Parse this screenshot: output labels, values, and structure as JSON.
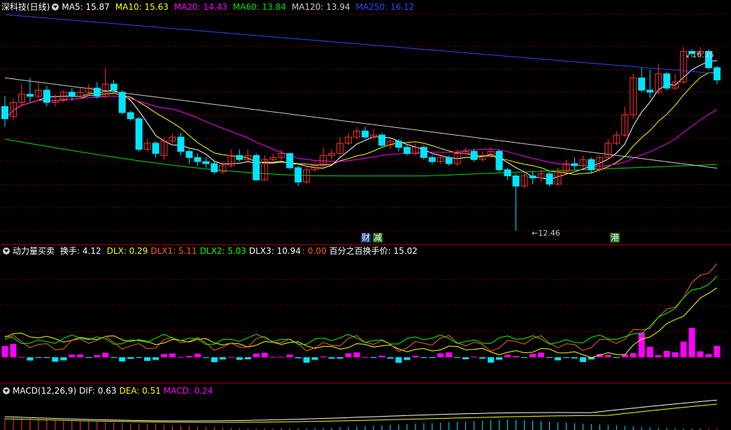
{
  "main_panel": {
    "title": "深科技(日线)",
    "ma": [
      {
        "label": "MA5: 15.87",
        "color": "#ffffff"
      },
      {
        "label": "MA10: 15.63",
        "color": "#ffff00"
      },
      {
        "label": "MA20: 14.43",
        "color": "#ff00ff"
      },
      {
        "label": "MA60: 13.84",
        "color": "#00e000"
      },
      {
        "label": "MA120: 13.94",
        "color": "#cccccc"
      },
      {
        "label": "MA250: 16.12",
        "color": "#3344ff"
      }
    ],
    "high_label": "16.35",
    "low_label": "12.46",
    "tags": [
      {
        "text": "财",
        "color": "#ffffff",
        "bg": "#1a3a8a"
      },
      {
        "text": "减",
        "color": "#ffffff",
        "bg": "#1f6e1f"
      },
      {
        "text": "港",
        "color": "#ffffff",
        "bg": "#1f6e1f"
      }
    ]
  },
  "power_panel": {
    "title": "动力量买卖",
    "items": [
      {
        "label": "换手: 4.12",
        "color": "#ffffff"
      },
      {
        "label": "DLX: 0.29",
        "color": "#ffff00"
      },
      {
        "label": "DLX1: 5.11",
        "color": "#ff6020"
      },
      {
        "label": "DLX2: 5.03",
        "color": "#00ff00"
      },
      {
        "label": "DLX3: 10.94",
        "color": "#ffffff"
      },
      {
        "label": ": 0.00",
        "color": "#ff6020"
      },
      {
        "label": "百分之百换手价: 15.02",
        "color": "#ffffff"
      }
    ]
  },
  "macd_panel": {
    "title": "MACD(12,26,9)",
    "items": [
      {
        "label": "DIF: 0.63",
        "color": "#ffffff"
      },
      {
        "label": "DEA: 0.51",
        "color": "#ffff00"
      },
      {
        "label": "MACD: 0.24",
        "color": "#ff00ff"
      }
    ]
  },
  "colors": {
    "up": "#ff3030",
    "down": "#00e5ff",
    "grid": "#7a0000",
    "divider": "#c00000",
    "ma5": "#ffffff",
    "ma10": "#ffff00",
    "ma20": "#ff00ff",
    "ma60": "#00e000",
    "ma120": "#cccccc",
    "ma250": "#3344ff",
    "dlx": "#ffff00",
    "dlx1": "#ff6020",
    "dlx2": "#00ff00",
    "bar_pos": "#ff00ff",
    "bar_neg": "#00e5ff"
  },
  "chart_data": {
    "type": "candlestick",
    "price_range": [
      12.2,
      17.8
    ],
    "candles": [
      [
        15.5,
        15.2,
        15.75,
        15.0
      ],
      [
        15.25,
        15.6,
        15.7,
        15.15
      ],
      [
        15.6,
        15.8,
        16.05,
        15.5
      ],
      [
        15.8,
        15.75,
        16.2,
        15.6
      ],
      [
        15.75,
        15.9,
        16.1,
        15.7
      ],
      [
        15.9,
        15.6,
        16.0,
        15.5
      ],
      [
        15.6,
        15.65,
        15.8,
        15.5
      ],
      [
        15.65,
        15.85,
        15.9,
        15.6
      ],
      [
        15.85,
        15.75,
        15.95,
        15.65
      ],
      [
        15.75,
        15.85,
        15.95,
        15.7
      ],
      [
        15.85,
        15.95,
        16.05,
        15.8
      ],
      [
        15.95,
        15.75,
        16.1,
        15.7
      ],
      [
        15.75,
        16.05,
        16.45,
        15.7
      ],
      [
        16.05,
        15.9,
        16.15,
        15.85
      ],
      [
        15.85,
        15.35,
        15.9,
        15.3
      ],
      [
        15.35,
        15.2,
        15.4,
        15.15
      ],
      [
        15.2,
        14.45,
        15.25,
        14.4
      ],
      [
        14.45,
        14.6,
        14.7,
        14.4
      ],
      [
        14.6,
        14.35,
        14.65,
        14.25
      ],
      [
        14.3,
        14.65,
        14.75,
        14.2
      ],
      [
        14.65,
        14.75,
        14.85,
        14.6
      ],
      [
        14.75,
        14.4,
        14.85,
        14.3
      ],
      [
        14.4,
        14.25,
        14.45,
        14.1
      ],
      [
        14.25,
        14.15,
        14.35,
        14.05
      ],
      [
        14.15,
        14.1,
        14.25,
        14.0
      ],
      [
        14.1,
        13.9,
        14.15,
        13.85
      ],
      [
        13.9,
        14.05,
        14.15,
        13.85
      ],
      [
        14.05,
        14.3,
        14.45,
        14.0
      ],
      [
        14.3,
        14.2,
        14.45,
        14.15
      ],
      [
        14.2,
        14.3,
        14.45,
        14.15
      ],
      [
        14.3,
        13.7,
        14.35,
        13.7
      ],
      [
        13.7,
        14.2,
        14.3,
        13.7
      ],
      [
        14.2,
        14.25,
        14.35,
        14.15
      ],
      [
        14.25,
        14.35,
        14.45,
        14.2
      ],
      [
        14.35,
        14.0,
        14.35,
        13.95
      ],
      [
        14.0,
        13.65,
        14.05,
        13.55
      ],
      [
        13.65,
        13.95,
        14.05,
        13.6
      ],
      [
        13.95,
        14.05,
        14.15,
        13.9
      ],
      [
        14.05,
        14.3,
        14.5,
        14.0
      ],
      [
        14.3,
        14.35,
        14.45,
        14.2
      ],
      [
        14.35,
        14.6,
        14.75,
        14.3
      ],
      [
        14.6,
        14.75,
        14.85,
        14.55
      ],
      [
        14.75,
        14.9,
        15.0,
        14.7
      ],
      [
        14.9,
        14.75,
        15.0,
        14.7
      ],
      [
        14.75,
        14.8,
        14.95,
        14.7
      ],
      [
        14.8,
        14.55,
        14.85,
        14.5
      ],
      [
        14.55,
        14.65,
        14.7,
        14.45
      ],
      [
        14.65,
        14.5,
        14.7,
        14.4
      ],
      [
        14.5,
        14.35,
        14.55,
        14.3
      ],
      [
        14.35,
        14.5,
        14.6,
        14.3
      ],
      [
        14.5,
        14.25,
        14.55,
        14.2
      ],
      [
        14.25,
        14.15,
        14.3,
        14.1
      ],
      [
        14.15,
        14.25,
        14.3,
        14.1
      ],
      [
        14.25,
        14.1,
        14.3,
        14.05
      ],
      [
        14.1,
        14.35,
        14.45,
        14.05
      ],
      [
        14.35,
        14.4,
        14.5,
        14.3
      ],
      [
        14.4,
        14.2,
        14.45,
        14.15
      ],
      [
        14.2,
        14.3,
        14.4,
        14.15
      ],
      [
        14.3,
        14.4,
        14.5,
        14.25
      ],
      [
        14.4,
        13.95,
        14.45,
        13.9
      ],
      [
        13.95,
        13.8,
        14.0,
        13.7
      ],
      [
        13.8,
        13.55,
        13.85,
        12.46
      ],
      [
        13.55,
        13.8,
        13.9,
        13.5
      ],
      [
        13.8,
        13.75,
        13.9,
        13.6
      ],
      [
        13.75,
        13.85,
        13.95,
        13.65
      ],
      [
        13.85,
        13.6,
        13.9,
        13.55
      ],
      [
        13.6,
        13.9,
        14.0,
        13.55
      ],
      [
        13.9,
        14.1,
        14.2,
        13.85
      ],
      [
        14.1,
        14.05,
        14.25,
        13.95
      ],
      [
        14.05,
        14.2,
        14.3,
        14.0
      ],
      [
        14.2,
        13.95,
        14.25,
        13.85
      ],
      [
        13.95,
        14.25,
        14.3,
        13.9
      ],
      [
        14.25,
        14.6,
        14.7,
        14.2
      ],
      [
        14.6,
        14.8,
        14.9,
        14.55
      ],
      [
        14.8,
        15.3,
        15.5,
        14.75
      ],
      [
        15.3,
        16.2,
        16.3,
        15.2
      ],
      [
        16.2,
        15.9,
        16.45,
        15.85
      ],
      [
        15.9,
        15.85,
        16.4,
        15.7
      ],
      [
        15.85,
        16.3,
        16.55,
        15.8
      ],
      [
        16.3,
        15.95,
        16.35,
        15.9
      ],
      [
        15.95,
        16.1,
        16.3,
        15.9
      ],
      [
        16.1,
        16.85,
        16.95,
        16.05
      ],
      [
        16.85,
        16.8,
        16.9,
        16.7
      ],
      [
        16.8,
        16.85,
        16.95,
        16.75
      ],
      [
        16.85,
        16.45,
        16.9,
        16.4
      ],
      [
        16.45,
        16.15,
        16.5,
        16.05
      ]
    ]
  }
}
